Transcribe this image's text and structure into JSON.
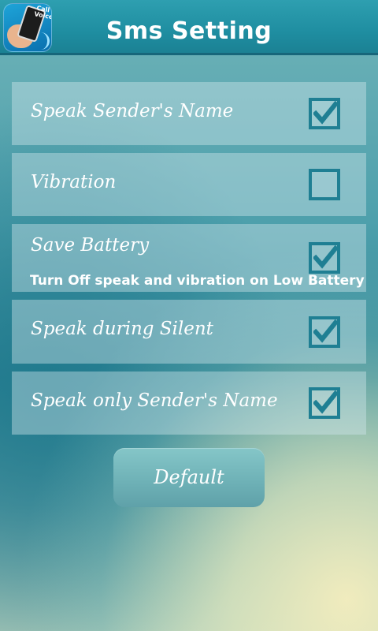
{
  "header": {
    "title": "Sms Setting",
    "app_icon": {
      "name": "app-icon",
      "badge_text": "Call Voice"
    }
  },
  "settings": [
    {
      "label": "Speak Sender's Name",
      "sublabel": "",
      "checked": true
    },
    {
      "label": "Vibration",
      "sublabel": "",
      "checked": false
    },
    {
      "label": "Save Battery",
      "sublabel": "Turn Off speak and vibration on Low Battery",
      "checked": true
    },
    {
      "label": "Speak during Silent",
      "sublabel": "",
      "checked": true
    },
    {
      "label": "Speak only Sender's Name",
      "sublabel": "",
      "checked": true
    }
  ],
  "default_button": {
    "label": "Default"
  },
  "colors": {
    "header": "#1f8ea1",
    "checkbox_border": "#1f7f93",
    "text": "#ffffff"
  }
}
